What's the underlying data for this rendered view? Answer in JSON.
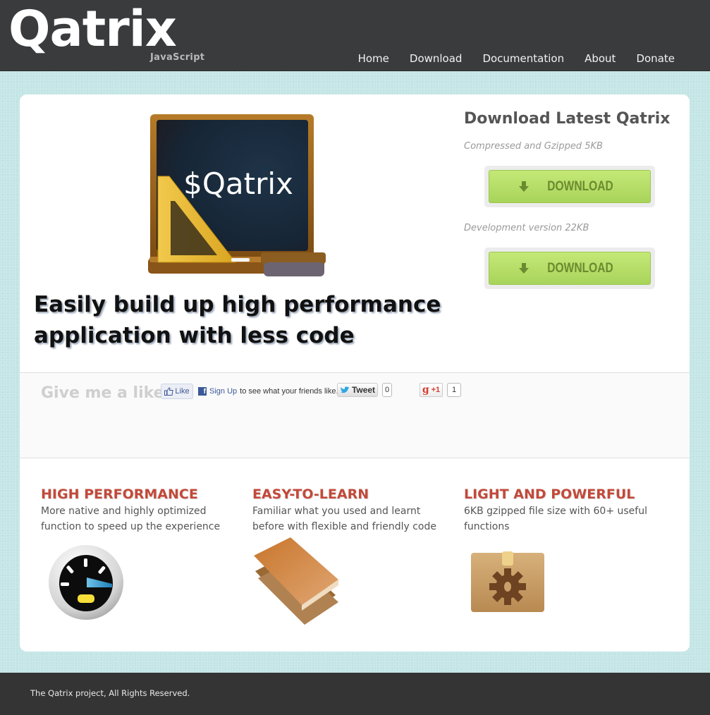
{
  "header": {
    "logo": "Qatrix",
    "logo_subtitle": "JavaScript",
    "nav": [
      {
        "label": "Home"
      },
      {
        "label": "Download"
      },
      {
        "label": "Documentation"
      },
      {
        "label": "About"
      },
      {
        "label": "Donate"
      }
    ]
  },
  "hero": {
    "board_text": "$Qatrix",
    "tagline_line1": "Easily build up high performance",
    "tagline_line2": "application with less code"
  },
  "download": {
    "title": "Download Latest Qatrix",
    "items": [
      {
        "description": "Compressed and Gzipped 5KB",
        "button_label": "DOWNLOAD",
        "icon": "download-arrow-icon"
      },
      {
        "description": "Development version 22KB",
        "button_label": "DOWNLOAD",
        "icon": "download-arrow-icon"
      }
    ],
    "accent": "#a8d45a"
  },
  "social": {
    "title": "Give me a like",
    "fb_like_label": "Like",
    "fb_signup_link": "Sign Up",
    "fb_signup_text": "to see what your friends like.",
    "tweet_label": "Tweet",
    "tweet_count": "0",
    "gplus_label": "+1",
    "gplus_count": "1"
  },
  "features": [
    {
      "title": "HIGH PERFORMANCE",
      "line1": "More native and highly optimized",
      "line2": "function to speed up the experience",
      "icon": "speedometer-icon"
    },
    {
      "title": "EASY-TO-LEARN",
      "line1": "Familiar what you used and learnt",
      "line2": "before with flexible and friendly code",
      "icon": "books-icon"
    },
    {
      "title": "LIGHT AND POWERFUL",
      "line1": "6KB gzipped file size with 60+ useful",
      "line2": "functions",
      "icon": "package-gear-icon"
    }
  ],
  "footer": {
    "text": "The Qatrix project, All Rights Reserved."
  },
  "colors": {
    "header_bg": "#3a3b3d",
    "page_bg": "#c4e6e6",
    "feature_title": "#c2493a",
    "footer_bg": "#343434"
  }
}
